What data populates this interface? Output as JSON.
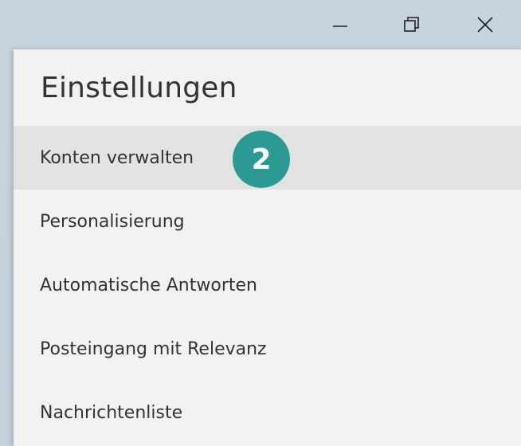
{
  "window": {
    "controls": [
      {
        "name": "minimize-icon"
      },
      {
        "name": "restore-icon"
      },
      {
        "name": "close-icon"
      }
    ]
  },
  "settings": {
    "title": "Einstellungen",
    "items": [
      {
        "label": "Konten verwalten",
        "selected": true
      },
      {
        "label": "Personalisierung"
      },
      {
        "label": "Automatische Antworten"
      },
      {
        "label": "Posteingang mit Relevanz"
      },
      {
        "label": "Nachrichtenliste"
      }
    ]
  },
  "annotation": {
    "step_number": "2",
    "color": "#2a9a93"
  },
  "colors": {
    "panel_bg": "#f2f2f2",
    "selected_bg": "#e3e3e3",
    "text": "#333333"
  }
}
